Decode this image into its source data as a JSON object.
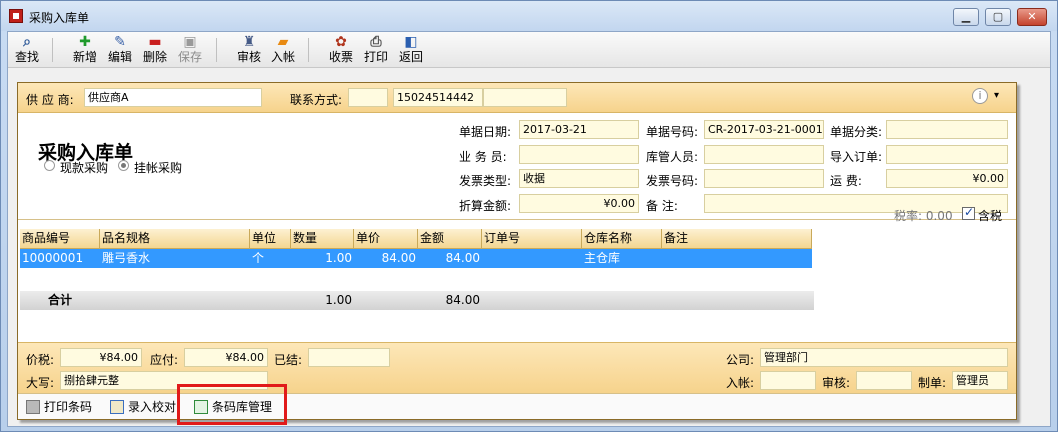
{
  "window": {
    "title": "采购入库单",
    "min_label": "▁",
    "max_label": "▢",
    "close_label": "✕"
  },
  "toolbar": [
    {
      "name": "find",
      "label": "查找",
      "icon": "binoculars-icon"
    },
    {
      "name": "add",
      "label": "新增",
      "icon": "plus-icon"
    },
    {
      "name": "edit",
      "label": "编辑",
      "icon": "pencil-icon"
    },
    {
      "name": "delete",
      "label": "删除",
      "icon": "minus-icon"
    },
    {
      "name": "save",
      "label": "保存",
      "icon": "floppy-icon",
      "disabled": true
    },
    {
      "name": "audit",
      "label": "审核",
      "icon": "stamp-icon"
    },
    {
      "name": "post",
      "label": "入帐",
      "icon": "ledger-icon"
    },
    {
      "name": "receive",
      "label": "收票",
      "icon": "receipt-icon"
    },
    {
      "name": "print",
      "label": "打印",
      "icon": "printer-icon"
    },
    {
      "name": "return",
      "label": "返回",
      "icon": "door-icon"
    }
  ],
  "header": {
    "supplier_label": "供 应 商:",
    "supplier_value": "供应商A",
    "contact_label": "联系方式:",
    "contact_value": "",
    "phone_value": "15024514442",
    "extra_value": ""
  },
  "doc": {
    "title": "采购入库单",
    "radio_cash": "现款采购",
    "radio_credit": "挂帐采购",
    "date_label": "单据日期:",
    "date_value": "2017-03-21",
    "no_label": "单据号码:",
    "no_value": "CR-2017-03-21-0001",
    "category_label": "单据分类:",
    "category_value": "",
    "salesman_label": "业 务 员:",
    "salesman_value": "",
    "keeper_label": "库管人员:",
    "keeper_value": "",
    "import_label": "导入订单:",
    "import_value": "",
    "invoice_type_label": "发票类型:",
    "invoice_type_value": "收据",
    "invoice_no_label": "发票号码:",
    "invoice_no_value": "",
    "freight_label": "运    费:",
    "freight_value": "¥0.00",
    "discount_label": "折算金额:",
    "discount_value": "¥0.00",
    "remark_label": "备    注:",
    "remark_value": ""
  },
  "tax": {
    "rate_label": "税率: 0.00",
    "include_label": "含税"
  },
  "grid": {
    "columns": [
      "商品编号",
      "品名规格",
      "单位",
      "数量",
      "单价",
      "金额",
      "订单号",
      "仓库名称",
      "备注"
    ],
    "rows": [
      {
        "code": "10000001",
        "name": "雕弓香水",
        "unit": "个",
        "qty": "1.00",
        "price": "84.00",
        "amount": "84.00",
        "order": "",
        "warehouse": "主仓库",
        "remark": ""
      }
    ],
    "total_label": "合计",
    "total_qty": "1.00",
    "total_amount": "84.00"
  },
  "footer": {
    "tax_price_label": "价税:",
    "tax_price_value": "¥84.00",
    "payable_label": "应付:",
    "payable_value": "¥84.00",
    "settled_label": "已结:",
    "settled_value": "",
    "company_label": "公司:",
    "company_value": "管理部门",
    "capital_label": "大写:",
    "capital_value": "捌拾肆元整",
    "posted_label": "入帐:",
    "posted_value": "",
    "audit_label": "审核:",
    "audit_value": "",
    "maker_label": "制单:",
    "maker_value": "管理员"
  },
  "bottom": {
    "print_barcode": "打印条码",
    "entry_check": "录入校对",
    "barcode_manage": "条码库管理"
  },
  "colors": {
    "accent": "#f6d38c",
    "selection": "#3399ff",
    "highlight": "#e11a1a"
  }
}
